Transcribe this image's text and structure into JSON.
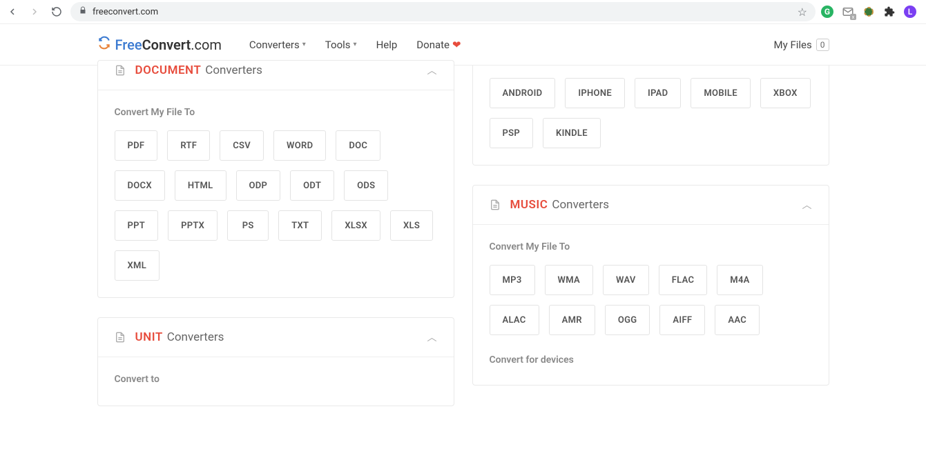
{
  "browser": {
    "url": "freeconvert.com"
  },
  "logo": {
    "part1": "Free",
    "part2": "Convert",
    "part3": ".com"
  },
  "nav": {
    "converters": "Converters",
    "tools": "Tools",
    "help": "Help",
    "donate": "Donate"
  },
  "myfiles": {
    "label": "My Files",
    "count": "0"
  },
  "cards": {
    "document": {
      "title": "DOCUMENT",
      "suffix": "Converters",
      "subtitle": "Convert My File To",
      "formats": [
        "PDF",
        "RTF",
        "CSV",
        "WORD",
        "DOC",
        "DOCX",
        "HTML",
        "ODP",
        "ODT",
        "ODS",
        "PPT",
        "PPTX",
        "PS",
        "TXT",
        "XLSX",
        "XLS",
        "XML"
      ]
    },
    "unit": {
      "title": "UNIT",
      "suffix": "Converters",
      "subtitle": "Convert to"
    },
    "device": {
      "formats": [
        "ANDROID",
        "IPHONE",
        "IPAD",
        "MOBILE",
        "XBOX",
        "PSP",
        "KINDLE"
      ]
    },
    "music": {
      "title": "MUSIC",
      "suffix": "Converters",
      "subtitle": "Convert My File To",
      "formats": [
        "MP3",
        "WMA",
        "WAV",
        "FLAC",
        "M4A",
        "ALAC",
        "AMR",
        "OGG",
        "AIFF",
        "AAC"
      ],
      "devices_label": "Convert for devices"
    }
  }
}
